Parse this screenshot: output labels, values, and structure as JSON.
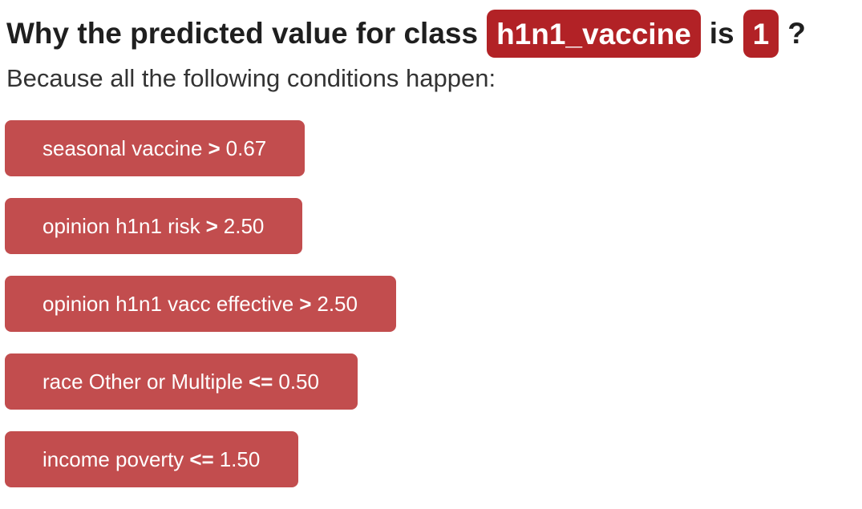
{
  "header": {
    "prefix": "Why the predicted value for class",
    "class_name": "h1n1_vaccine",
    "middle": "is",
    "predicted_value": "1",
    "suffix": "?"
  },
  "subtitle": "Because all the following conditions happen:",
  "conditions": [
    {
      "feature": "seasonal vaccine",
      "operator": ">",
      "threshold": "0.67"
    },
    {
      "feature": "opinion h1n1 risk",
      "operator": ">",
      "threshold": "2.50"
    },
    {
      "feature": "opinion h1n1 vacc effective",
      "operator": ">",
      "threshold": "2.50"
    },
    {
      "feature": "race Other or Multiple",
      "operator": "<=",
      "threshold": "0.50"
    },
    {
      "feature": "income poverty",
      "operator": "<=",
      "threshold": "1.50"
    }
  ],
  "colors": {
    "highlight_pill": "#b22226",
    "condition_box": "#c24d4e"
  }
}
